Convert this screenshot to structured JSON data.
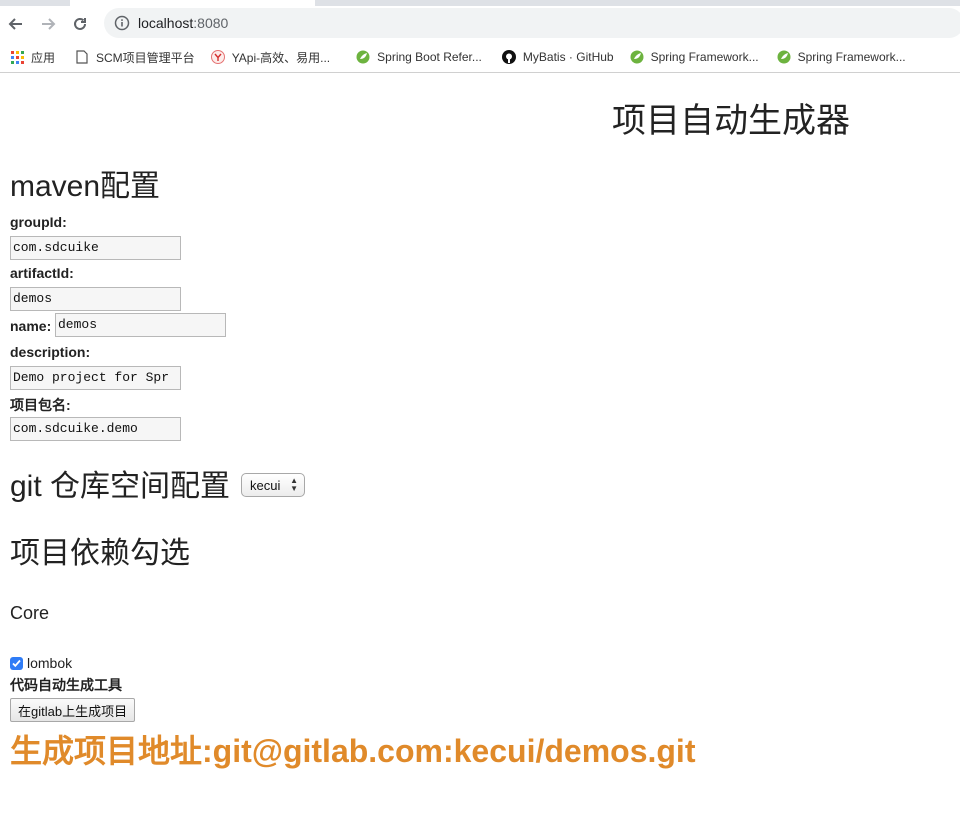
{
  "browser": {
    "url_host": "localhost",
    "url_port": ":8080",
    "bookmarks": [
      {
        "label": "应用",
        "icon": "apps-grid-icon"
      },
      {
        "label": "SCM项目管理平台",
        "icon": "page-icon"
      },
      {
        "label": "YApi-高效、易用...",
        "icon": "yapi-icon"
      },
      {
        "label": "Spring Boot Refer...",
        "icon": "spring-icon"
      },
      {
        "label": "MyBatis · GitHub",
        "icon": "github-icon"
      },
      {
        "label": "Spring Framework...",
        "icon": "spring-icon"
      },
      {
        "label": "Spring Framework...",
        "icon": "spring-icon"
      }
    ]
  },
  "page": {
    "title": "项目自动生成器",
    "maven_heading": "maven配置",
    "fields": {
      "group_id": {
        "label": "groupId:",
        "value": "com.sdcuike"
      },
      "artifact_id": {
        "label": "artifactId:",
        "value": "demos"
      },
      "name": {
        "label": "name:",
        "value": "demos"
      },
      "description": {
        "label": "description:",
        "value": "Demo project for Spr"
      },
      "package": {
        "label": "项目包名:",
        "value": "com.sdcuike.demo"
      }
    },
    "git_heading": "git 仓库空间配置",
    "git_select": {
      "selected": "kecui"
    },
    "deps_heading": "项目依赖勾选",
    "core_heading": "Core",
    "lombok": {
      "label": "lombok",
      "checked": true
    },
    "tool_label": "代码自动生成工具",
    "generate_button": "在gitlab上生成项目",
    "result_text": "生成项目地址:git@gitlab.com:kecui/demos.git"
  },
  "colors": {
    "accent": "#2f7cf6",
    "result": "#e08a2a"
  }
}
